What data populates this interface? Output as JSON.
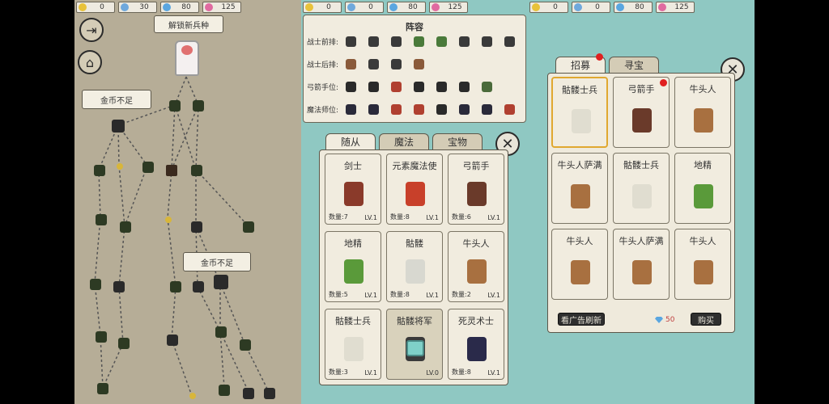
{
  "resource_bars": [
    [
      {
        "icon": "coin-icon",
        "value": "0"
      },
      {
        "icon": "energy-icon",
        "value": "30"
      },
      {
        "icon": "diamond-icon",
        "value": "80"
      },
      {
        "icon": "ticket-icon",
        "value": "125"
      }
    ],
    [
      {
        "icon": "coin-icon",
        "value": "0"
      },
      {
        "icon": "energy-icon",
        "value": "0"
      },
      {
        "icon": "diamond-icon",
        "value": "80"
      },
      {
        "icon": "ticket-icon",
        "value": "125"
      }
    ],
    [
      {
        "icon": "coin-icon",
        "value": "0"
      },
      {
        "icon": "energy-icon",
        "value": "0"
      },
      {
        "icon": "diamond-icon",
        "value": "80"
      },
      {
        "icon": "ticket-icon",
        "value": "125"
      }
    ]
  ],
  "colors": {
    "coin": "#e8c23a",
    "energy": "#6fa8dc",
    "diamond": "#5aa6e0",
    "ticket": "#e06aa0"
  },
  "map": {
    "unlock_tip": "解锁新兵种",
    "coin_tip_1": "金币不足",
    "coin_tip_2": "金币不足"
  },
  "lineup": {
    "title": "阵容",
    "rows": [
      {
        "label": "战士前排:",
        "colors": [
          "#3a3a3a",
          "#3a3a3a",
          "#3a3a3a",
          "#4a7a3a",
          "#4a7a3a",
          "#3a3a3a",
          "#3a3a3a",
          "#3a3a3a"
        ]
      },
      {
        "label": "战士后排:",
        "colors": [
          "#8a5a3a",
          "#3a3a3a",
          "#3a3a3a",
          "#8a5a3a"
        ]
      },
      {
        "label": "弓箭手位:",
        "colors": [
          "#2a2a2a",
          "#2a2a2a",
          "#b04030",
          "#2a2a2a",
          "#2a2a2a",
          "#2a2a2a",
          "#4a6a3a"
        ]
      },
      {
        "label": "魔法师位:",
        "colors": [
          "#2a2a3a",
          "#2a2a3a",
          "#b04030",
          "#b04030",
          "#2a2a2a",
          "#2a2a3a",
          "#2a2a3a",
          "#b04030"
        ]
      }
    ]
  },
  "roster": {
    "tabs": [
      "随从",
      "魔法",
      "宝物"
    ],
    "cards": [
      {
        "name": "剑士",
        "count": "数量:7",
        "lv": "LV.1",
        "color": "#8a3a2a",
        "locked": false
      },
      {
        "name": "元素魔法使",
        "count": "数量:8",
        "lv": "LV.1",
        "color": "#c8402a",
        "locked": false
      },
      {
        "name": "弓箭手",
        "count": "数量:6",
        "lv": "LV.1",
        "color": "#6a3a2a",
        "locked": false
      },
      {
        "name": "地精",
        "count": "数量:5",
        "lv": "LV.1",
        "color": "#5a9a3a",
        "locked": false
      },
      {
        "name": "骷髅",
        "count": "数量:8",
        "lv": "LV.1",
        "color": "#d8d8d0",
        "locked": false
      },
      {
        "name": "牛头人",
        "count": "数量:2",
        "lv": "LV.1",
        "color": "#a87040",
        "locked": false
      },
      {
        "name": "骷髅士兵",
        "count": "数量:3",
        "lv": "LV.1",
        "color": "#e0ddd0",
        "locked": false
      },
      {
        "name": "骷髅将军",
        "count": "",
        "lv": "LV.0",
        "color": "#3a3a3a",
        "locked": true
      },
      {
        "name": "死灵术士",
        "count": "数量:8",
        "lv": "LV.1",
        "color": "#2a2a4a",
        "locked": false
      }
    ]
  },
  "shop": {
    "tabs": [
      "招募",
      "寻宝"
    ],
    "cards": [
      {
        "name": "骷髅士兵",
        "color": "#e0ddd0",
        "selected": true,
        "dot": false
      },
      {
        "name": "弓箭手",
        "color": "#6a3a2a",
        "selected": false,
        "dot": true
      },
      {
        "name": "牛头人",
        "color": "#a87040",
        "selected": false,
        "dot": false
      },
      {
        "name": "牛头人萨满",
        "color": "#a87040",
        "selected": false,
        "dot": false
      },
      {
        "name": "骷髅士兵",
        "color": "#e0ddd0",
        "selected": false,
        "dot": false
      },
      {
        "name": "地精",
        "color": "#5a9a3a",
        "selected": false,
        "dot": false
      },
      {
        "name": "牛头人",
        "color": "#a87040",
        "selected": false,
        "dot": false
      },
      {
        "name": "牛头人萨满",
        "color": "#a87040",
        "selected": false,
        "dot": false
      },
      {
        "name": "牛头人",
        "color": "#a87040",
        "selected": false,
        "dot": false
      }
    ],
    "ad_refresh": "看广告刷新",
    "price": "50",
    "buy": "购买"
  }
}
